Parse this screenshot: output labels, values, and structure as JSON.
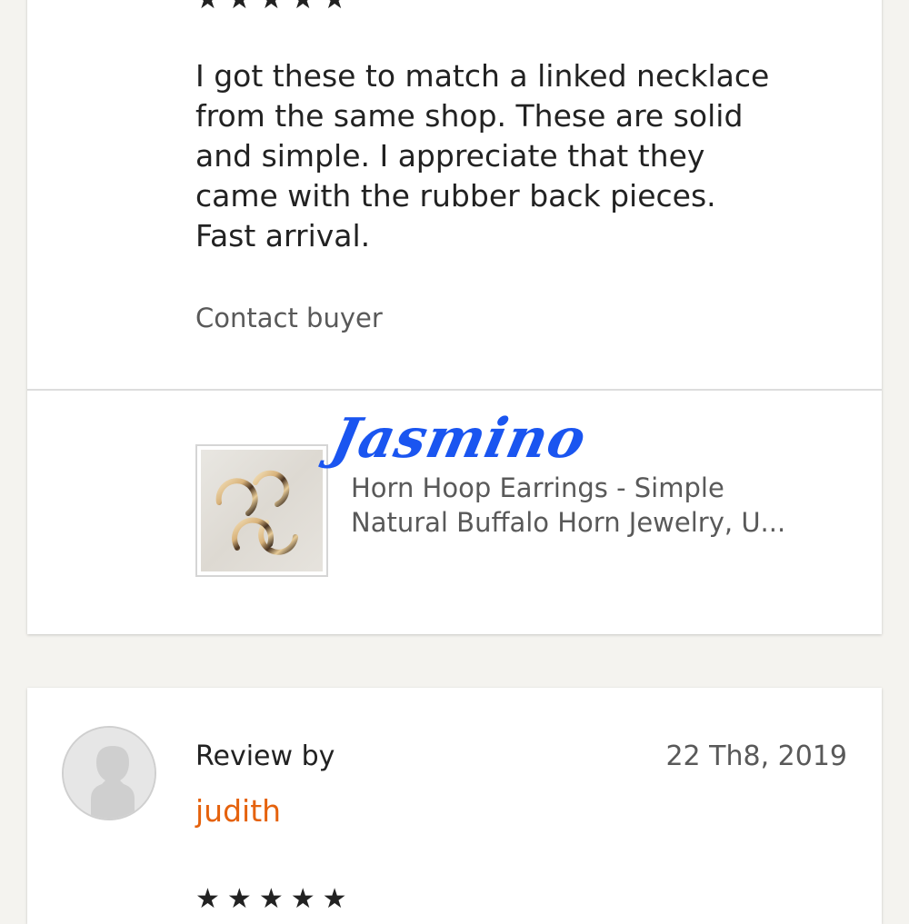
{
  "review_top": {
    "rating": "★★★★★",
    "text": "I got these to match a linked necklace\nfrom the same shop.  These are solid\nand simple.  I appreciate that they\ncame with the rubber back pieces.\nFast arrival.",
    "contact_label": "Contact buyer",
    "product": {
      "title_line1": "Horn Hoop Earrings - Simple",
      "title_line2": "Natural Buffalo Horn Jewelry, U..."
    },
    "watermark": "Jasmino"
  },
  "review_bottom": {
    "review_by_label": "Review by",
    "reviewer": "judith",
    "date": "22 Th8, 2019",
    "rating": "★★★★★"
  },
  "colors": {
    "page_background": "#f4f3ef",
    "card_background": "#ffffff",
    "reviewer_name": "#e5620d",
    "muted_text": "#595959",
    "watermark": "#1a55f0"
  }
}
